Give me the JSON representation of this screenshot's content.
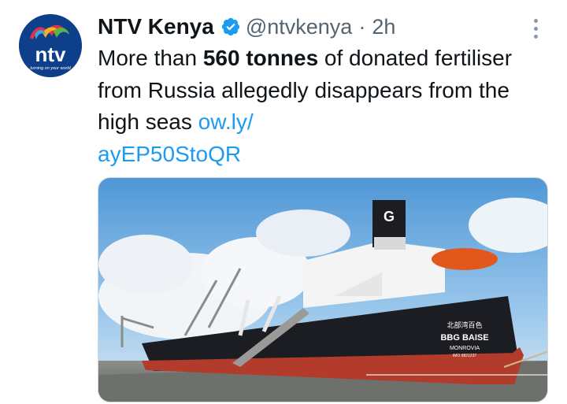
{
  "tweet": {
    "author": {
      "display_name": "NTV Kenya",
      "handle": "@ntvkenya",
      "avatar_text": "ntv",
      "avatar_tagline": "turning on your world",
      "verified_icon": "verified-badge-icon"
    },
    "separator": "·",
    "timestamp": "2h",
    "text": {
      "part1": "More than ",
      "bold": "560 tonnes",
      "part2": " of donated fertiliser from Russia allegedly disappears from the high seas ",
      "link_line1": "ow.ly/",
      "link_line2": "ayEP50StoQR"
    },
    "media": {
      "ship_name_chinese": "北部湾百色",
      "ship_name": "BBG BAISE",
      "port": "MONROVIA",
      "imo": "IMO 9821237",
      "funnel_letter": "G"
    },
    "more_icon": "more-options-icon"
  },
  "colors": {
    "text": "#0f1419",
    "secondary": "#536471",
    "link": "#1d9bf0",
    "verified": "#1d9bf0"
  }
}
